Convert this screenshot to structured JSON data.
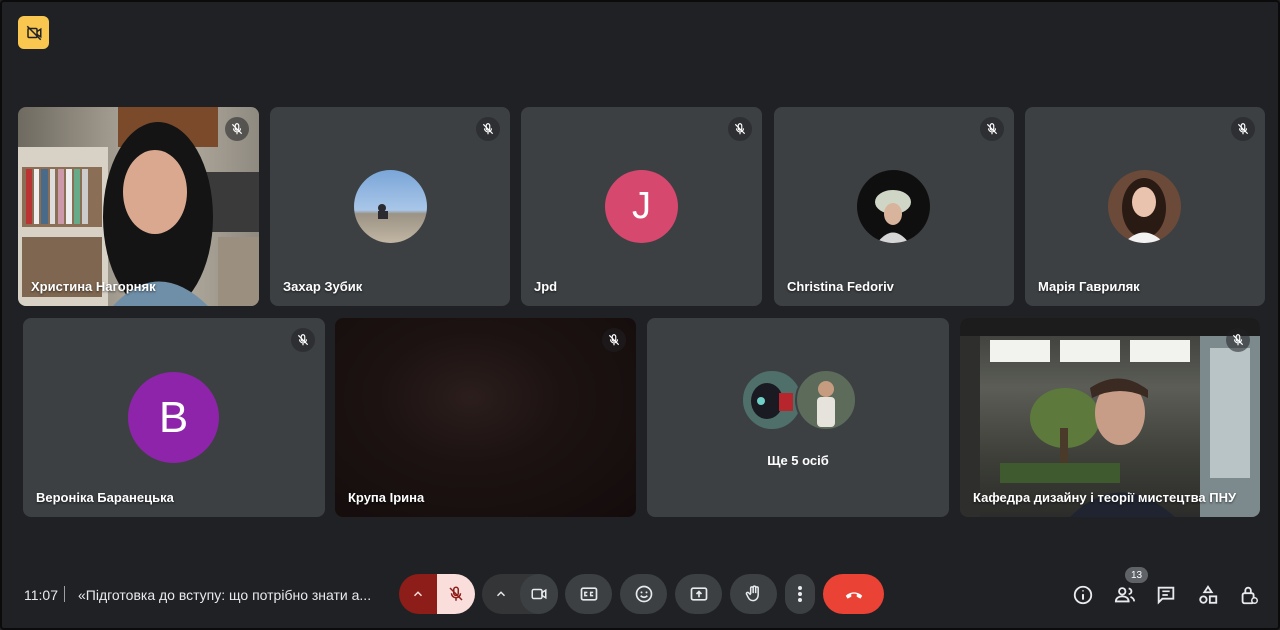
{
  "participants": [
    {
      "name": "Христина Нагорняк",
      "kind": "video"
    },
    {
      "name": "Захар Зубик",
      "kind": "photo-avatar"
    },
    {
      "name": "Jpd",
      "kind": "letter-avatar",
      "letter": "J",
      "color": "#d7486f"
    },
    {
      "name": "Christina Fedoriv",
      "kind": "photo-avatar"
    },
    {
      "name": "Марія Гавриляк",
      "kind": "photo-avatar"
    },
    {
      "name": "Вероніка Баранецька",
      "kind": "letter-avatar",
      "letter": "B",
      "color": "#8e24aa"
    },
    {
      "name": "Крупа Ірина",
      "kind": "video"
    },
    {
      "name": "Ще 5 осіб",
      "kind": "others"
    },
    {
      "name": "Кафедра дизайну і теорії мистецтва ПНУ",
      "kind": "video"
    }
  ],
  "meeting": {
    "time": "11:07",
    "title": "«Підготовка до вступу: що потрібно знати а..."
  },
  "people_count": "13",
  "colors": {
    "background": "#202124",
    "tile": "#3c4043",
    "hangup": "#ea4335",
    "mic_active": "#f9dedc",
    "mic_group": "#8c1d18",
    "record_badge": "#f9c74f"
  },
  "icons": [
    "recording-icon",
    "mic-off-icon",
    "chevron-up-icon",
    "camera-icon",
    "captions-icon",
    "emoji-icon",
    "present-icon",
    "raise-hand-icon",
    "more-vert-icon",
    "end-call-icon",
    "info-icon",
    "people-icon",
    "chat-icon",
    "activities-icon",
    "host-controls-icon"
  ]
}
